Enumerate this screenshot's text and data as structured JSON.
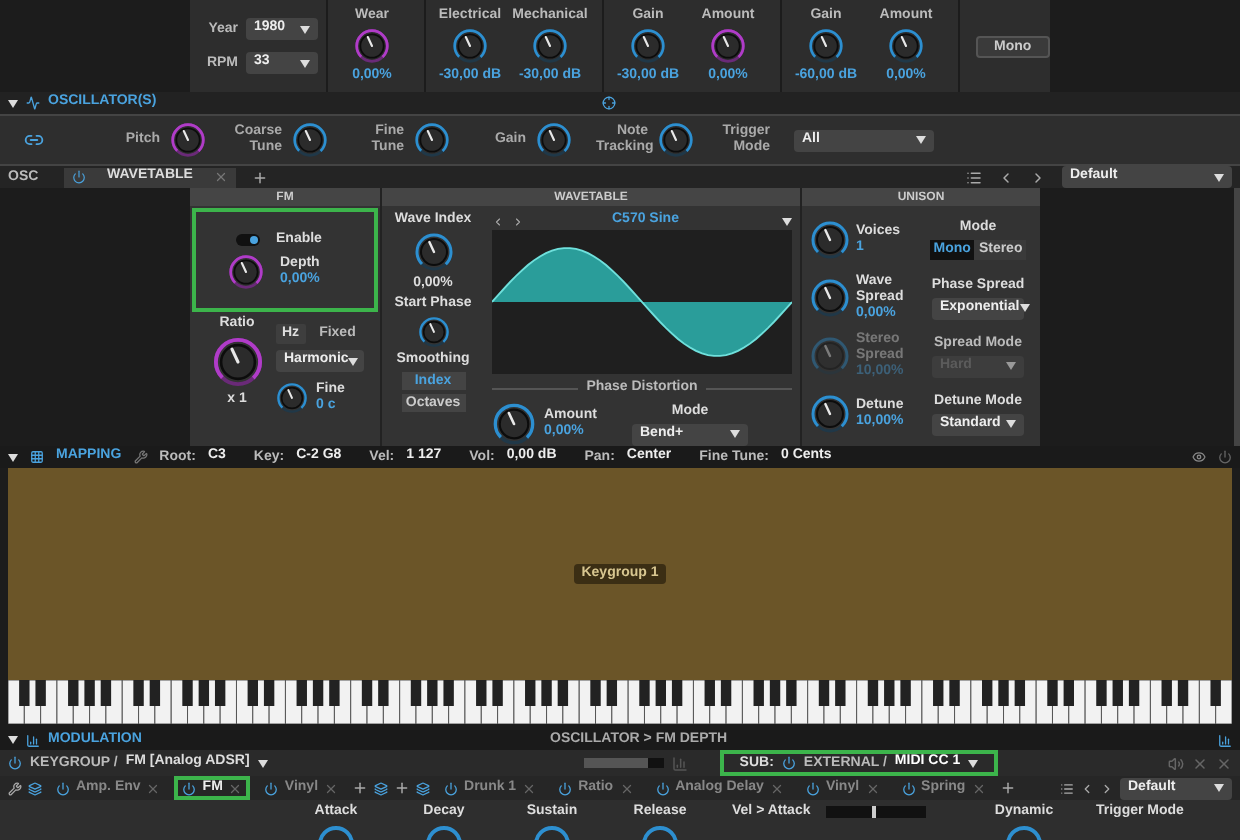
{
  "effects": {
    "selects": [
      {
        "label": "Year",
        "value": "1980"
      },
      {
        "label": "RPM",
        "value": "33"
      }
    ],
    "knob_groups": [
      {
        "knobs": [
          {
            "label": "Wear",
            "value": "0,00%",
            "modulated": true
          }
        ]
      },
      {
        "knobs": [
          {
            "label": "Electrical",
            "value": "-30,00 dB",
            "modulated": false
          },
          {
            "label": "Mechanical",
            "value": "-30,00 dB",
            "modulated": false
          }
        ]
      },
      {
        "knobs": [
          {
            "label": "Gain",
            "value": "-30,00 dB",
            "modulated": false
          },
          {
            "label": "Amount",
            "value": "0,00%",
            "modulated": true
          }
        ]
      },
      {
        "knobs": [
          {
            "label": "Gain",
            "value": "-60,00 dB",
            "modulated": false
          },
          {
            "label": "Amount",
            "value": "0,00%",
            "modulated": false
          }
        ]
      }
    ],
    "button": "Mono"
  },
  "oscillators": {
    "title": "OSCILLATOR(S)",
    "knobs": [
      {
        "label": "Pitch",
        "modulated": true
      },
      {
        "label": "Coarse Tune",
        "modulated": false
      },
      {
        "label": "Fine Tune",
        "modulated": false
      },
      {
        "label": "Gain",
        "modulated": false
      },
      {
        "label": "Note Tracking",
        "modulated": false
      }
    ],
    "trigger_mode": {
      "label": "Trigger Mode",
      "value": "All"
    }
  },
  "osc_bar": {
    "label": "OSC",
    "tabs": [
      {
        "label": "WAVETABLE",
        "selected": true,
        "on": true
      }
    ],
    "preset": "Default"
  },
  "fm": {
    "title": "FM",
    "highlighted": true,
    "enable": {
      "label": "Enable",
      "on": true
    },
    "depth": {
      "label": "Depth",
      "value": "0,00%",
      "modulated": true
    },
    "ratio": {
      "label": "Ratio",
      "value": "x 1",
      "modulated": true
    },
    "units": [
      {
        "label": "Hz",
        "selected": true
      },
      {
        "label": "Fixed",
        "selected": false
      }
    ],
    "ratio_mode": "Harmonic",
    "fine": {
      "label": "Fine",
      "value": "0 c",
      "modulated": false
    }
  },
  "wavetable": {
    "title": "WAVETABLE",
    "wave_index": {
      "label": "Wave Index",
      "value": "0,00%"
    },
    "start_phase": {
      "label": "Start Phase"
    },
    "smoothing": {
      "label": "Smoothing",
      "options": [
        {
          "label": "Index",
          "selected": true
        },
        {
          "label": "Octaves",
          "selected": false
        }
      ]
    },
    "display": {
      "name": "C570 Sine"
    },
    "phase_distortion": {
      "title": "Phase Distortion",
      "amount": {
        "label": "Amount",
        "value": "0,00%"
      },
      "mode": {
        "label": "Mode",
        "value": "Bend+"
      }
    }
  },
  "unison": {
    "title": "UNISON",
    "knobs": [
      {
        "label": "Voices",
        "value": "1",
        "disabled": false
      },
      {
        "label": "Wave Spread",
        "value": "0,00%",
        "disabled": false
      },
      {
        "label": "Stereo Spread",
        "value": "10,00%",
        "disabled": true
      },
      {
        "label": "Detune",
        "value": "10,00%",
        "disabled": false
      }
    ],
    "mode": {
      "label": "Mode",
      "options": [
        {
          "label": "Mono",
          "selected": true
        },
        {
          "label": "Stereo",
          "selected": false
        }
      ]
    },
    "selects": [
      {
        "label": "Phase Spread",
        "value": "Exponential",
        "disabled": false
      },
      {
        "label": "Spread Mode",
        "value": "Hard",
        "disabled": true
      },
      {
        "label": "Detune Mode",
        "value": "Standard",
        "disabled": false
      }
    ]
  },
  "mapping": {
    "title": "MAPPING",
    "fields": [
      {
        "label": "Root:",
        "value": "C3"
      },
      {
        "label": "Key:",
        "value": "C-2 G8"
      },
      {
        "label": "Vel:",
        "value": "1 127"
      },
      {
        "label": "Vol:",
        "value": "0,00 dB"
      },
      {
        "label": "Pan:",
        "value": "Center"
      },
      {
        "label": "Fine Tune:",
        "value": "0 Cents"
      }
    ],
    "keygroup": "Keygroup 1"
  },
  "modulation": {
    "title": "MODULATION",
    "path": "OSCILLATOR > FM DEPTH",
    "source": {
      "parent": "KEYGROUP /",
      "name": "FM [Analog ADSR]"
    },
    "amount": {
      "level": 0.8
    },
    "sub": {
      "label": "SUB:",
      "parent": "EXTERNAL /",
      "name": "MIDI CC 1",
      "highlighted": true
    },
    "tabs": [
      {
        "kind": "tools"
      },
      {
        "kind": "stack"
      },
      {
        "kind": "tab",
        "label": "Amp. Env",
        "highlighted": false
      },
      {
        "kind": "tab",
        "label": "FM",
        "highlighted": true
      },
      {
        "kind": "tab",
        "label": "Vinyl",
        "highlighted": false
      },
      {
        "kind": "add"
      },
      {
        "kind": "stack"
      },
      {
        "kind": "add"
      },
      {
        "kind": "stack"
      },
      {
        "kind": "tab",
        "label": "Drunk 1",
        "highlighted": false
      },
      {
        "kind": "tab",
        "label": "Ratio",
        "highlighted": false
      },
      {
        "kind": "tab",
        "label": "Analog Delay",
        "highlighted": false
      },
      {
        "kind": "tab",
        "label": "Vinyl",
        "highlighted": false
      },
      {
        "kind": "tab",
        "label": "Spring",
        "highlighted": false
      },
      {
        "kind": "add"
      }
    ],
    "preset": "Default",
    "envelope": [
      {
        "kind": "knob",
        "label": "Attack"
      },
      {
        "kind": "knob",
        "label": "Decay"
      },
      {
        "kind": "knob",
        "label": "Sustain"
      },
      {
        "kind": "knob",
        "label": "Release"
      },
      {
        "kind": "slider",
        "label": "Vel > Attack",
        "level": 0.5
      },
      {
        "kind": "knob",
        "label": "Dynamic"
      },
      {
        "kind": "label",
        "label": "Trigger Mode"
      }
    ]
  }
}
